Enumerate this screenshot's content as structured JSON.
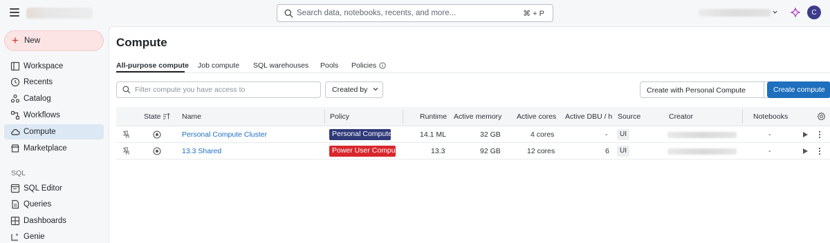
{
  "search": {
    "placeholder": "Search data, notebooks, recents, and more...",
    "shortcut": "⌘ + P"
  },
  "user": {
    "avatar_initial": "C"
  },
  "sidebar": {
    "new_label": "New",
    "items": [
      {
        "label": "Workspace",
        "icon": "workspace-icon"
      },
      {
        "label": "Recents",
        "icon": "clock-icon"
      },
      {
        "label": "Catalog",
        "icon": "catalog-icon"
      },
      {
        "label": "Workflows",
        "icon": "workflows-icon"
      },
      {
        "label": "Compute",
        "icon": "cloud-icon",
        "active": true
      },
      {
        "label": "Marketplace",
        "icon": "store-icon"
      }
    ],
    "section_sql": "SQL",
    "sql_items": [
      {
        "label": "SQL Editor",
        "icon": "sql-editor-icon"
      },
      {
        "label": "Queries",
        "icon": "queries-icon"
      },
      {
        "label": "Dashboards",
        "icon": "dashboards-icon"
      },
      {
        "label": "Genie",
        "icon": "genie-icon"
      }
    ]
  },
  "main": {
    "title": "Compute",
    "tabs": [
      {
        "label": "All-purpose compute",
        "active": true
      },
      {
        "label": "Job compute"
      },
      {
        "label": "SQL warehouses"
      },
      {
        "label": "Pools"
      },
      {
        "label": "Policies"
      }
    ],
    "filter_placeholder": "Filter compute you have access to",
    "created_by_label": "Created by",
    "create_personal_label": "Create with Personal Compute",
    "create_compute_label": "Create compute"
  },
  "table": {
    "headers": {
      "state": "State",
      "name": "Name",
      "policy": "Policy",
      "runtime": "Runtime",
      "active_memory": "Active memory",
      "active_cores": "Active cores",
      "active_dbu": "Active DBU / h",
      "source": "Source",
      "creator": "Creator",
      "notebooks": "Notebooks"
    },
    "rows": [
      {
        "name": "Personal Compute Cluster",
        "policy": "Personal Compute",
        "policy_color": "#2f3a7a",
        "runtime": "14.1 ML",
        "active_memory": "32 GB",
        "active_cores": "4 cores",
        "active_dbu": "-",
        "source": "UI",
        "notebooks": "-"
      },
      {
        "name": "13.3 Shared",
        "policy": "Power User Compute",
        "policy_color": "#d9272e",
        "runtime": "13.3",
        "active_memory": "92 GB",
        "active_cores": "12 cores",
        "active_dbu": "6",
        "source": "UI",
        "notebooks": "-"
      }
    ]
  },
  "colors": {
    "accent": "#1e6fbd",
    "new_button_bg": "#fce4e4",
    "active_nav_bg": "#dde8f5"
  }
}
